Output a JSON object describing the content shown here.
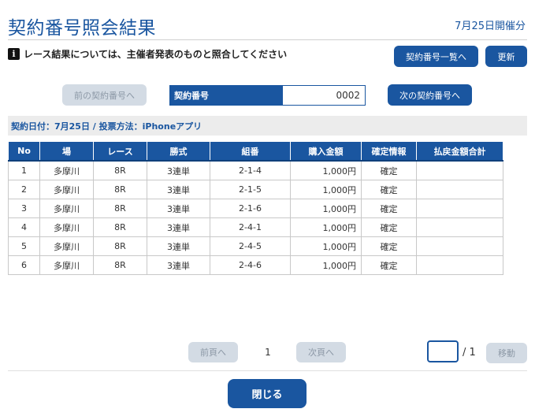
{
  "header": {
    "title": "契約番号照会結果",
    "date_label": "7月25日開催分"
  },
  "notice": {
    "icon": "info-icon",
    "text": "レース結果については、主催者発表のものと照合してください"
  },
  "toolbar": {
    "list_label": "契約番号一覧へ",
    "refresh_label": "更新"
  },
  "contract": {
    "prev_label": "前の契約番号へ",
    "field_label": "契約番号",
    "value": "0002",
    "next_label": "次の契約番号へ"
  },
  "info_bar": {
    "text": "契約日付：7月25日 / 投票方法：iPhoneアプリ"
  },
  "table": {
    "headers": [
      "No",
      "場",
      "レース",
      "勝式",
      "組番",
      "購入金額",
      "確定情報",
      "払戻金額合計"
    ],
    "rows": [
      [
        "1",
        "多摩川",
        "8R",
        "3連単",
        "2-1-4",
        "1,000円",
        "確定",
        ""
      ],
      [
        "2",
        "多摩川",
        "8R",
        "3連単",
        "2-1-5",
        "1,000円",
        "確定",
        ""
      ],
      [
        "3",
        "多摩川",
        "8R",
        "3連単",
        "2-1-6",
        "1,000円",
        "確定",
        ""
      ],
      [
        "4",
        "多摩川",
        "8R",
        "3連単",
        "2-4-1",
        "1,000円",
        "確定",
        ""
      ],
      [
        "5",
        "多摩川",
        "8R",
        "3連単",
        "2-4-5",
        "1,000円",
        "確定",
        ""
      ],
      [
        "6",
        "多摩川",
        "8R",
        "3連単",
        "2-4-6",
        "1,000円",
        "確定",
        ""
      ]
    ]
  },
  "pager": {
    "prev_label": "前頁へ",
    "current": "1",
    "next_label": "次頁へ",
    "input_value": "",
    "total": "/ 1",
    "move_label": "移動"
  },
  "footer": {
    "close_label": "閉じる"
  },
  "colors": {
    "accent": "#1a56a0",
    "disabled": "#d3dbe4",
    "info_bar": "#ececec"
  }
}
